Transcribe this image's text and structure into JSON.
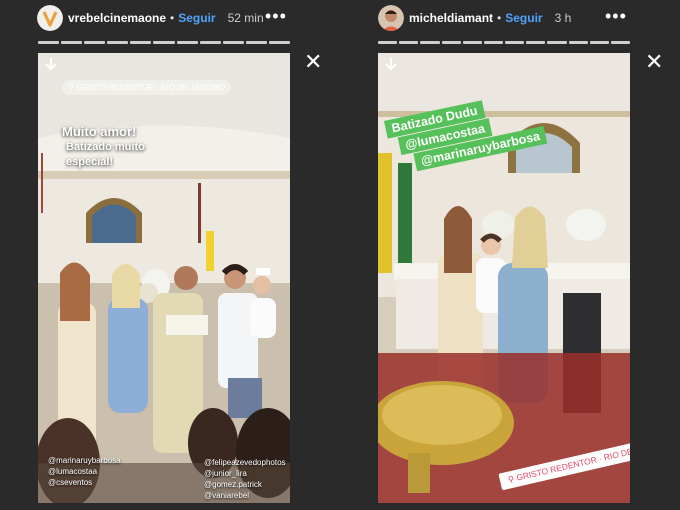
{
  "stories": [
    {
      "username": "vrebelcinemaone",
      "follow_label": "Seguir",
      "separator": "•",
      "time": "52 min",
      "more_label": "•••",
      "close_label": "✕",
      "location": "GRISTO REDENTOR · RIO DE JANEIRO",
      "caption_lines": [
        "Muito amor!",
        "Batizado muito",
        "especial!"
      ],
      "tags_left": [
        "@marinaruybarbosa",
        "@lumacostaa",
        "@cseventos"
      ],
      "tags_right": [
        "@felipeazevedophotos",
        "@junior_lira",
        "@gomez.patrick",
        "@vaniarebel"
      ]
    },
    {
      "username": "micheldiamant",
      "follow_label": "Seguir",
      "separator": "•",
      "time": "3 h",
      "more_label": "•••",
      "close_label": "✕",
      "caption_lines": [
        "Batizado Dudu",
        "@lumacostaa",
        "@marinaruybarbosa"
      ],
      "location": "GRISTO REDENTOR · RIO DE JANEIRO"
    }
  ],
  "colors": {
    "background": "#2a2a2a",
    "follow": "#4fa3ff",
    "caption_green": "#56c05a",
    "location_text": "#e04a6a"
  },
  "icons": [
    "vrebel-logo-avatar",
    "user-avatar",
    "more-options-icon",
    "close-icon",
    "download-icon"
  ]
}
